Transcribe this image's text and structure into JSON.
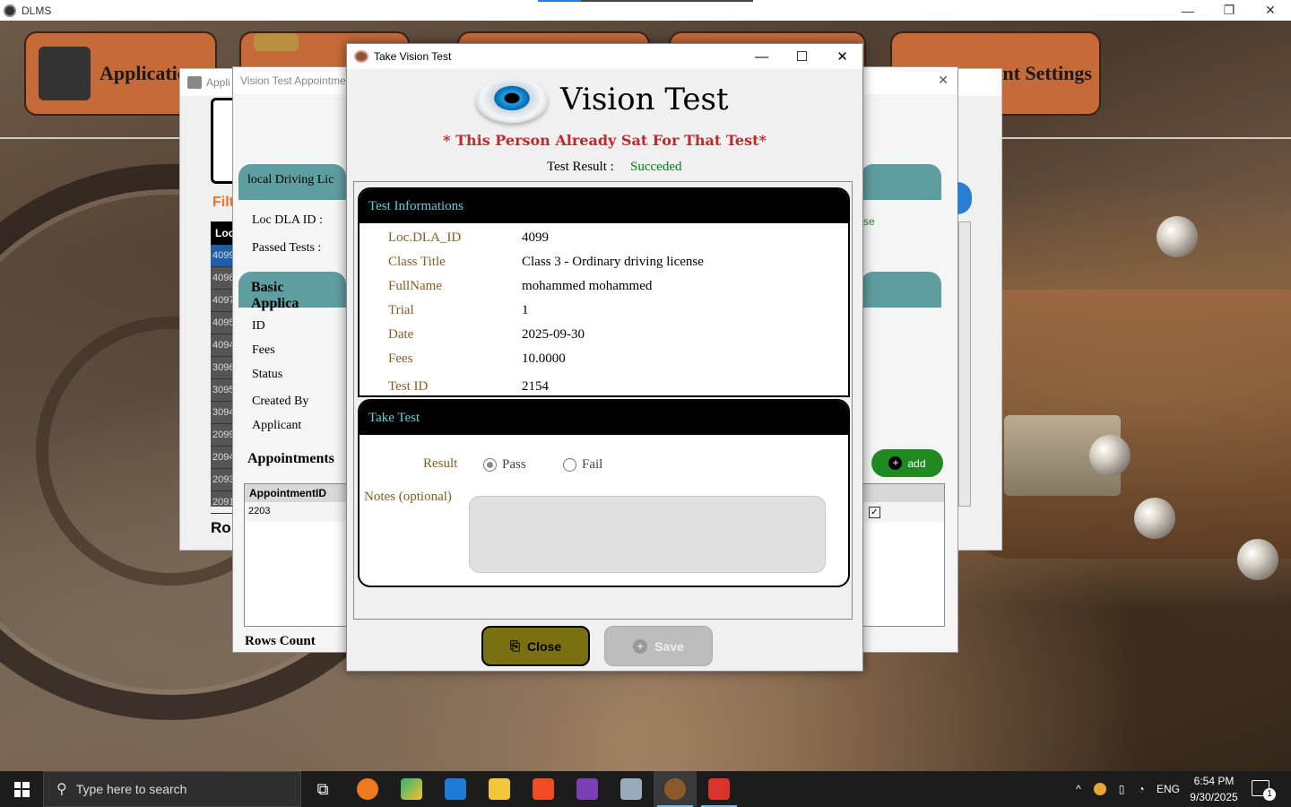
{
  "app": {
    "title": "DLMS",
    "min": "—",
    "max": "❐",
    "close": "✕"
  },
  "menu": {
    "applications": "Applicatio",
    "settings": "nt Settings"
  },
  "back_window_1": {
    "title": "Appli",
    "filter_label": "Filt",
    "list_header": "Loc",
    "list_items": [
      "4099",
      "4098",
      "4097",
      "4095",
      "4094",
      "3096",
      "3095",
      "3094",
      "2099",
      "2094",
      "2093",
      "2091"
    ],
    "rows_label": "Ro"
  },
  "back_window_2": {
    "title": "Vision Test Appointme",
    "local_header": "local Driving Lic",
    "loc_dla_id_label": "Loc DLA ID :",
    "passed_tests_label": "Passed Tests :",
    "basic_header": "Basic Applica",
    "fields": [
      "ID",
      "Fees",
      "Status",
      "Created By",
      "Applicant"
    ],
    "appointments_label": "Appointments",
    "table_header": "AppointmentID",
    "table_row": "2203",
    "rows_count_label": "Rows Count",
    "add_button": "add",
    "side_text": "se"
  },
  "dialog": {
    "title": "Take Vision Test",
    "min": "—",
    "max": "☐",
    "close": "✕",
    "heading": "Vision Test",
    "warning": "* This Person Already Sat For That Test*",
    "result_label": "Test Result :",
    "result_value": "Succeded",
    "info": {
      "header": "Test Informations",
      "rows": [
        {
          "label": "Loc.DLA_ID",
          "value": "4099"
        },
        {
          "label": "Class Title",
          "value": "Class 3 - Ordinary driving license"
        },
        {
          "label": "FullName",
          "value": "mohammed mohammed"
        },
        {
          "label": "Trial",
          "value": "1"
        },
        {
          "label": "Date",
          "value": "2025-09-30"
        },
        {
          "label": "Fees",
          "value": "10.0000"
        },
        {
          "label": "Test ID",
          "value": "2154"
        }
      ]
    },
    "take": {
      "header": "Take Test",
      "result_label": "Result",
      "pass": "Pass",
      "fail": "Fail",
      "selected": "Pass",
      "notes_label": "Notes (optional)",
      "notes_value": ""
    },
    "close_button": "Close",
    "save_button": "Save"
  },
  "taskbar": {
    "search_placeholder": "Type here to search",
    "lang": "ENG",
    "time": "6:54 PM",
    "date": "9/30/2025",
    "notif_count": "1"
  },
  "colors": {
    "menu_button": "#c66a3a",
    "teal": "#5f9ea0",
    "warning": "#c0282d",
    "success": "#0a7a1a",
    "label": "#8a5a22",
    "close_button": "#7a7010"
  }
}
